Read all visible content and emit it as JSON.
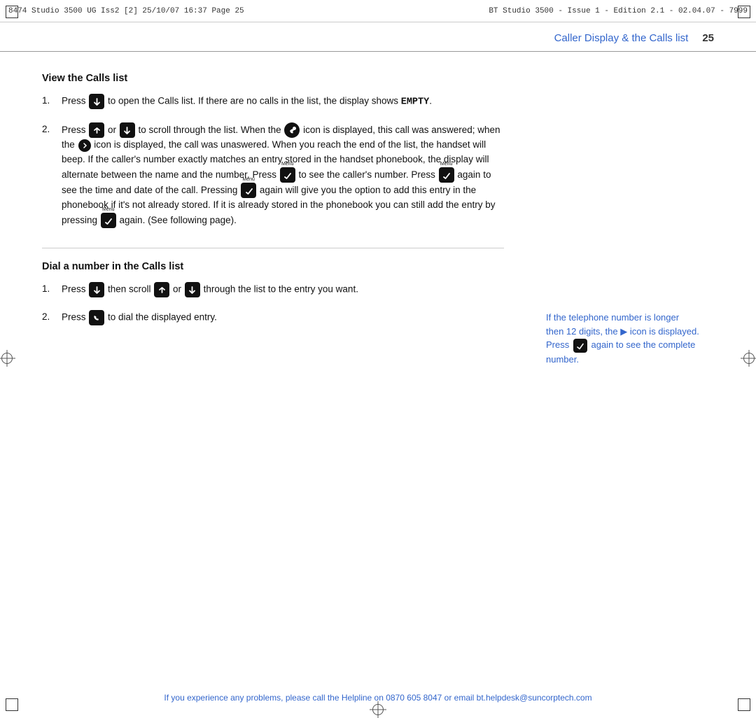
{
  "print_header": {
    "left": "8474 Studio 3500 UG Iss2 [2]   25/10/07  16:37  Page 25",
    "right": "BT Studio 3500 - Issue 1 - Edition 2.1 - 02.04.07 - 7999"
  },
  "page_title": {
    "text": "Caller Display & the Calls list",
    "page_number": "25"
  },
  "section1": {
    "heading": "View the Calls list",
    "items": [
      {
        "number": "1.",
        "text_before_icon": "Press",
        "icon1": "calls-button",
        "text_after_icon": "to open the Calls list. If there are no calls in the list, the display shows",
        "empty_text": "EMPTY",
        "text_end": "."
      },
      {
        "number": "2.",
        "text_before_icon": "Press",
        "icon1": "up-button",
        "text_mid1": "or",
        "icon2": "down-button",
        "text_after": "to scroll through the list. When the",
        "icon3": "answered-icon",
        "text3": "icon is displayed, this call was answered; when the",
        "icon4": "unanswered-icon",
        "text4": "icon is displayed, the call was unaswered. When you reach the end of the list, the handset will beep."
      }
    ],
    "paragraphs": [
      "If the caller's number exactly matches an entry stored in the handset phonebook, the display will alternate between the name and the number.",
      "Press [menu] to see the caller's number.",
      "Press [menu] again to see the time and date of the call.",
      "Pressing [menu] again will give you the option to add this entry in the phonebook if it's not already stored. If it is already stored in the phonebook you can still add the entry by pressing [menu] again. (See following page)."
    ]
  },
  "section2": {
    "heading": "Dial a number in the Calls list",
    "items": [
      {
        "number": "1.",
        "text": "Press [calls] then scroll [up] or [down] through the list to the entry you want."
      },
      {
        "number": "2.",
        "text": "Press [phone] to dial the displayed entry."
      }
    ]
  },
  "right_note": {
    "line1": "If the telephone number is longer",
    "line2": "then 12 digits, the ▶ icon is displayed.",
    "line3": "Press",
    "icon": "menu-button",
    "line4": "again to see the complete",
    "line5": "number."
  },
  "footer": {
    "text": "If you experience any problems, please call the Helpline on 0870 605 8047 or email bt.helpdesk@suncorptech.com"
  }
}
